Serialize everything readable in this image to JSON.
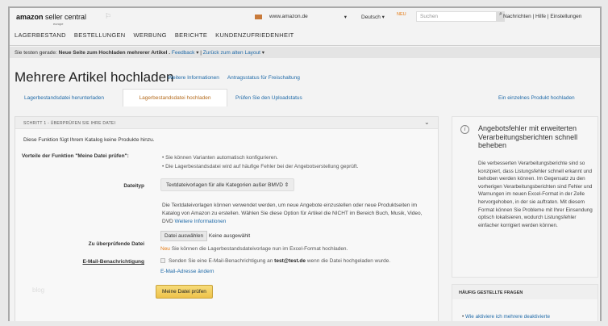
{
  "header": {
    "logo": "amazon seller central",
    "logo_sub": "europe",
    "marketplace": "www.amazon.de",
    "language": "Deutsch",
    "new_badge": "NEU",
    "search_placeholder": "Suchen",
    "links": [
      "Nachrichten",
      "Hilfe",
      "Einstellungen"
    ]
  },
  "nav": [
    "LAGERBESTAND",
    "BESTELLUNGEN",
    "WERBUNG",
    "BERICHTE",
    "KUNDENZUFRIEDENHEIT"
  ],
  "testbar": {
    "prefix": "Sie testen gerade:",
    "page": "Neue Seite zum Hochladen mehrerer Artikel .",
    "feedback": "Feedback",
    "back": "Zurück zum alten Layout"
  },
  "page": {
    "title": "Mehrere Artikel hochladen",
    "link1": "Weitere Informationen",
    "link2": "Antragsstatus für Freischaltung"
  },
  "tabs": [
    "Lagerbestandsdatei herunterladen",
    "Lagerbestandsdatei hochladen",
    "Prüfen Sie den Uploadstatus"
  ],
  "single_upload": "Ein einzelnes Produkt hochladen",
  "step": {
    "header": "SCHRITT 1 - ÜBERPRÜFEN SIE IHRE DATEI",
    "intro": "Diese Funktion fügt Ihrem Katalog keine Produkte hinzu.",
    "benefits_label": "Vorteile der Funktion \"Meine Datei prüfen\":",
    "benefits": [
      "Sie können Varianten automatisch konfigurieren.",
      "Die Lagerbestandsdatei wird auf häufige Fehler bei der Angebotserstellung geprüft."
    ],
    "filetype_label": "Dateityp",
    "filetype_value": "Textdateivorlagen für alle Kategorien außer BMVD",
    "filetype_desc": "Die Textdateivorlagen können verwendet werden, um neue Angebote einzustellen oder neue Produktseiten im Katalog von Amazon zu erstellen. Wählen Sie diese Option für Artikel die NICHT im Bereich Buch, Musik, Video, DVD",
    "more_info": "Weitere Informationen",
    "file_label": "Zu überprüfende Datei",
    "file_button": "Datei auswählen",
    "file_none": "Keine ausgewählt",
    "new_label": "Neu",
    "new_note": "Sie können die Lagerbestandsdateivorlage nun im Excel-Format hochladen.",
    "email_label": "E-Mail-Benachrichtigung",
    "email_text1": "Senden Sie eine E-Mail-Benachrichtigung an",
    "email": "test@test.de",
    "email_text2": "wenn die Datei hochgeladen wurde.",
    "email_change": "E-Mail-Adresse ändern",
    "submit": "Meine Datei prüfen"
  },
  "watermark": "blog",
  "sidebar": {
    "title": "Angebotsfehler mit erweiterten Verarbeitungsberichten schnell beheben",
    "text": "Die verbesserten Verarbeitungsberichte sind so konzipiert, dass Listungsfehler schnell erkannt und behoben werden können. Im Gegensatz zu den vorherigen Verarbeitungsberichten sind Fehler und Warnungen im neuen Excel-Format in der Zelle hervorgehoben, in der sie auftraten. Mit diesem Format können Sie Probleme mit Ihrer Einsendung optisch lokalisieren, wodurch Listungsfehler einfacher korrigiert werden können.",
    "faq_title": "HÄUFIG GESTELLTE FRAGEN",
    "faq_item": "Wie aktiviere ich mehrere deaktivierte"
  }
}
